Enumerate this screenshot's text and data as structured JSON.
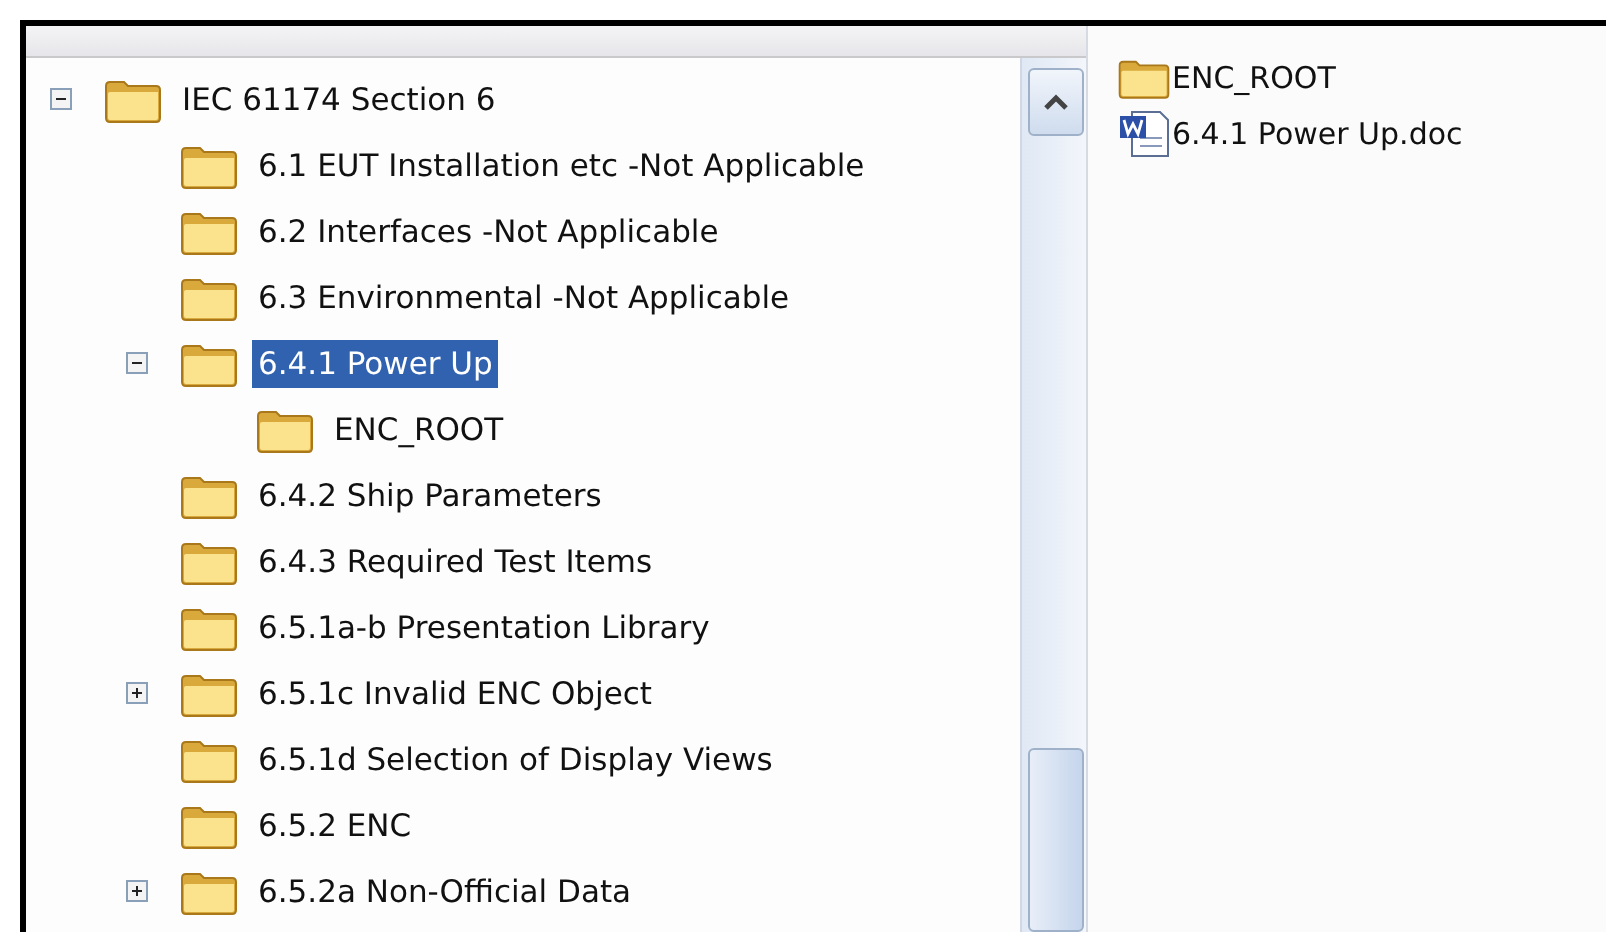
{
  "tree": {
    "label": "IEC 61174 Section 6",
    "expanded": true,
    "selected": false,
    "children": [
      {
        "label": "6.1 EUT Installation etc -Not Applicable",
        "selected": false
      },
      {
        "label": "6.2 Interfaces -Not Applicable",
        "selected": false
      },
      {
        "label": "6.3 Environmental -Not Applicable",
        "selected": false
      },
      {
        "label": "6.4.1 Power Up",
        "expanded": true,
        "selected": true,
        "children": [
          {
            "label": "ENC_ROOT",
            "selected": false
          }
        ]
      },
      {
        "label": "6.4.2 Ship Parameters",
        "selected": false
      },
      {
        "label": "6.4.3 Required Test Items",
        "selected": false
      },
      {
        "label": "6.5.1a-b Presentation Library",
        "selected": false
      },
      {
        "label": "6.5.1c Invalid ENC Object",
        "expanded": false,
        "selected": false
      },
      {
        "label": "6.5.1d Selection of Display Views",
        "selected": false
      },
      {
        "label": "6.5.2 ENC",
        "selected": false
      },
      {
        "label": "6.5.2a Non-Official Data",
        "expanded": false,
        "selected": false
      }
    ]
  },
  "files": [
    {
      "kind": "folder",
      "name": "ENC_ROOT"
    },
    {
      "kind": "word_doc",
      "name": "6.4.1 Power Up.doc"
    }
  ]
}
